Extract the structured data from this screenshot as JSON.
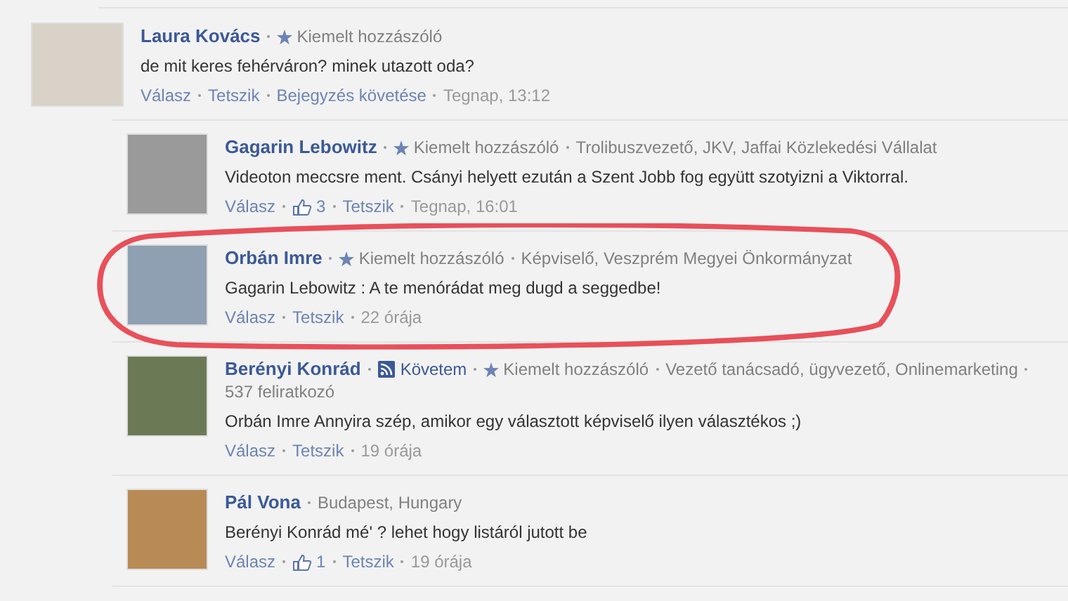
{
  "comments": [
    {
      "name": "Laura Kovács",
      "meta": [
        {
          "kind": "featured",
          "text": "Kiemelt hozzászóló"
        }
      ],
      "body": "de mit keres fehérváron? minek utazott oda?",
      "actions": [
        {
          "kind": "link",
          "text": "Válasz"
        },
        {
          "kind": "link",
          "text": "Tetszik"
        },
        {
          "kind": "link",
          "text": "Bejegyzés követése"
        },
        {
          "kind": "time",
          "text": "Tegnap, 13:12"
        }
      ],
      "highlighted": false,
      "replies": [
        {
          "name": "Gagarin Lebowitz",
          "meta": [
            {
              "kind": "featured",
              "text": "Kiemelt hozzászóló"
            },
            {
              "kind": "text",
              "text": "Trolibuszvezető, JKV, Jaffai Közlekedési Vállalat"
            }
          ],
          "body": "Videoton meccsre ment. Csányi helyett ezután a Szent Jobb fog együtt szotyizni a Viktorral.",
          "actions": [
            {
              "kind": "link",
              "text": "Válasz"
            },
            {
              "kind": "like",
              "text": "3"
            },
            {
              "kind": "link",
              "text": "Tetszik"
            },
            {
              "kind": "time",
              "text": "Tegnap, 16:01"
            }
          ],
          "highlighted": false
        },
        {
          "name": "Orbán Imre",
          "meta": [
            {
              "kind": "featured",
              "text": "Kiemelt hozzászóló"
            },
            {
              "kind": "text",
              "text": "Képviselő, Veszprém Megyei Önkormányzat"
            }
          ],
          "body": "Gagarin Lebowitz : A te menórádat meg dugd a seggedbe!",
          "actions": [
            {
              "kind": "link",
              "text": "Válasz"
            },
            {
              "kind": "link",
              "text": "Tetszik"
            },
            {
              "kind": "time",
              "text": "22 órája"
            }
          ],
          "highlighted": true
        },
        {
          "name": "Berényi Konrád",
          "meta": [
            {
              "kind": "follow",
              "text": "Követem"
            },
            {
              "kind": "featured",
              "text": "Kiemelt hozzászóló"
            },
            {
              "kind": "text",
              "text": "Vezető tanácsadó, ügyvezető, Onlinemarketing"
            },
            {
              "kind": "text",
              "text": "537 feliratkozó"
            }
          ],
          "body": "Orbán Imre Annyira szép, amikor egy választott képviselő ilyen választékos ;)",
          "actions": [
            {
              "kind": "link",
              "text": "Válasz"
            },
            {
              "kind": "link",
              "text": "Tetszik"
            },
            {
              "kind": "time",
              "text": "19 órája"
            }
          ],
          "highlighted": false
        },
        {
          "name": "Pál Vona",
          "meta": [
            {
              "kind": "text",
              "text": "Budapest, Hungary"
            }
          ],
          "body": "Berényi Konrád mé' ? lehet hogy listáról jutott be",
          "actions": [
            {
              "kind": "link",
              "text": "Válasz"
            },
            {
              "kind": "like",
              "text": "1"
            },
            {
              "kind": "link",
              "text": "Tetszik"
            },
            {
              "kind": "time",
              "text": "19 órája"
            }
          ],
          "highlighted": false
        }
      ]
    }
  ]
}
